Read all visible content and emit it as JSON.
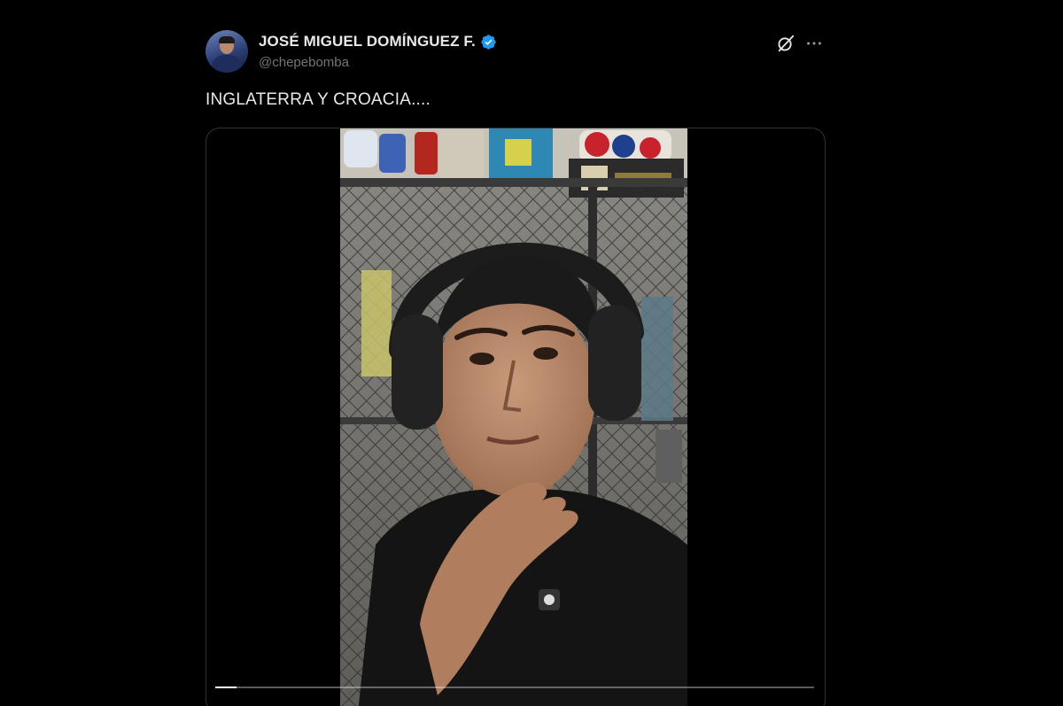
{
  "tweet": {
    "author": {
      "display_name": "JOSÉ MIGUEL DOMÍNGUEZ F.",
      "handle": "@chepebomba",
      "verified": true
    },
    "text": "INGLATERRA Y CROACIA....",
    "icons": {
      "grok": "grok-icon",
      "more": "more-icon",
      "verified": "verified-badge-icon"
    },
    "video": {
      "progress_fraction": 0.035
    }
  },
  "colors": {
    "background": "#000000",
    "text_primary": "#e7e9ea",
    "text_secondary": "#71767b",
    "verified_blue": "#1d9bf0",
    "border": "#2f3336"
  }
}
